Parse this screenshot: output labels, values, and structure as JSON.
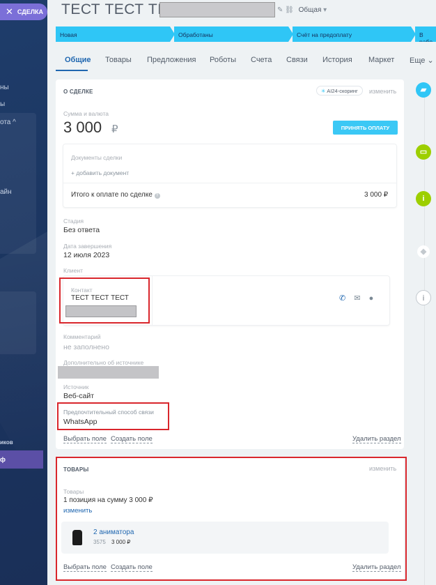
{
  "sidebar": {
    "deal_button_label": "СДЕЛКА",
    "fragments": [
      "ны",
      "ы",
      "ота ^",
      "айн",
      "иков",
      "ф"
    ]
  },
  "header": {
    "title": "ТЕСТ ТЕСТ ТЕСТ,",
    "category_label": "Общая"
  },
  "stages": [
    "Новая",
    "Обработаны",
    "Счёт на предоплату",
    "В рабо"
  ],
  "tabs": [
    "Общие",
    "Товары",
    "Предложения",
    "Роботы",
    "Счета",
    "Связи",
    "История",
    "Маркет",
    "Еще"
  ],
  "about_deal": {
    "title": "О СДЕЛКЕ",
    "ai_badge": "AI24-скоринг",
    "edit_link": "изменить",
    "amount_label": "Сумма и валюта",
    "amount_value": "3 000",
    "currency_symbol": "₽",
    "pay_button": "ПРИНЯТЬ ОПЛАТУ",
    "documents_label": "Документы сделки",
    "add_document": "+ добавить документ",
    "total_label": "Итого к оплате по сделке",
    "total_value": "3 000 ₽",
    "stage_label": "Стадия",
    "stage_value": "Без ответа",
    "close_date_label": "Дата завершения",
    "close_date_value": "12 июля 2023",
    "client_label": "Клиент",
    "contact_label": "Контакт",
    "contact_name": "ТЕСТ ТЕСТ ТЕСТ",
    "comment_label": "Комментарий",
    "comment_value": "не заполнено",
    "source_extra_label": "Дополнительно об источнике",
    "source_label": "Источник",
    "source_value": "Веб-сайт",
    "pref_contact_label": "Предпочтительный способ связи",
    "pref_contact_value": "WhatsApp",
    "select_field": "Выбрать поле",
    "create_field": "Создать поле",
    "delete_section": "Удалить раздел"
  },
  "products": {
    "title": "ТОВАРЫ",
    "edit_link": "изменить",
    "label": "Товары",
    "summary": "1 позиция на сумму 3 000 ₽",
    "change_link": "изменить",
    "item_name": "2 аниматора",
    "item_code": "3575",
    "item_price": "3 000 ₽",
    "select_field": "Выбрать поле",
    "create_field": "Создать поле",
    "delete_section": "Удалить раздел"
  },
  "colors": {
    "accent": "#2fc6f6",
    "link_blue": "#2067b0",
    "highlight_red": "#d9262c",
    "timeline_blue": "#2fc6f6",
    "timeline_green": "#9dcf00",
    "timeline_gray": "#c3c9ce"
  },
  "timeline_icons": [
    "chat-icon",
    "comment-icon",
    "info-icon",
    "tag-icon",
    "info-outline-icon"
  ]
}
